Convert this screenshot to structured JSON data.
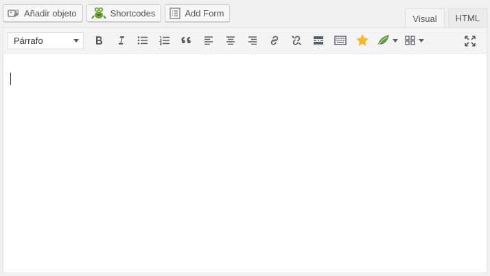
{
  "media_buttons": {
    "add_media": {
      "label": "Añadir objeto",
      "icon": "media-icon"
    },
    "shortcodes": {
      "label": "Shortcodes",
      "icon": "frog-mascot-icon"
    },
    "add_form": {
      "label": "Add Form",
      "icon": "form-list-icon"
    }
  },
  "tabs": [
    {
      "label": "Visual",
      "active": true
    },
    {
      "label": "HTML",
      "active": false
    }
  ],
  "toolbar": {
    "format_select": {
      "value": "Párrafo"
    },
    "buttons": [
      "bold-icon",
      "italic-icon",
      "bullet-list-icon",
      "numbered-list-icon",
      "blockquote-icon",
      "align-left-icon",
      "align-center-icon",
      "align-right-icon",
      "link-icon",
      "unlink-icon",
      "read-more-icon",
      "toolbar-toggle-icon",
      "star-icon",
      "leaf-icon",
      "grid-icon",
      "fullscreen-icon"
    ]
  },
  "colors": {
    "star": "#f6b921",
    "leaf": "#5a9e3a",
    "frog": "#6aa832"
  },
  "editor": {
    "content": ""
  }
}
